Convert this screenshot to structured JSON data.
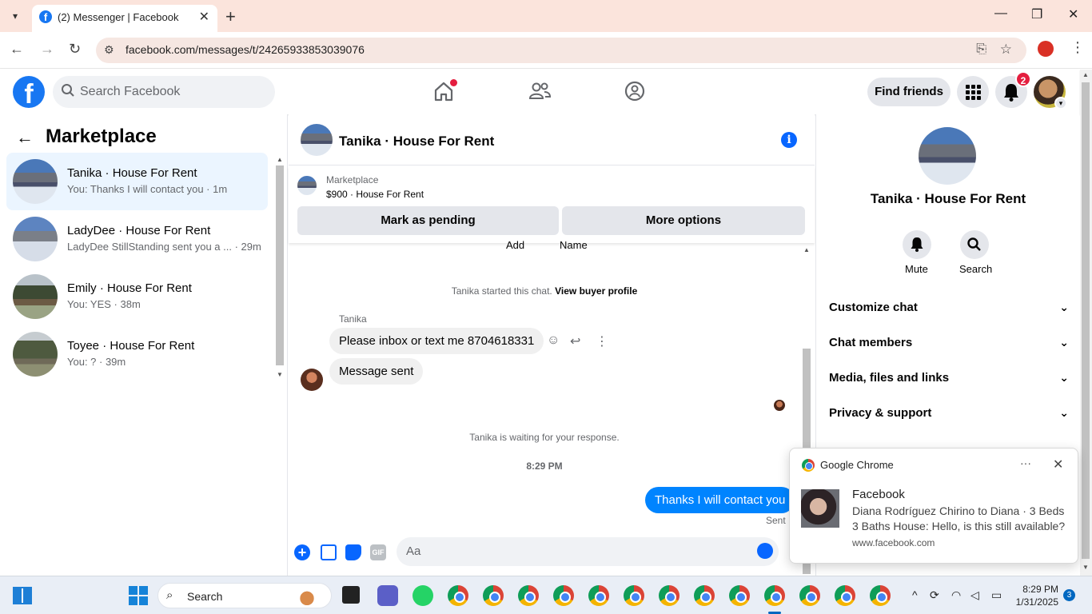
{
  "browser": {
    "tab_title": "(2) Messenger | Facebook",
    "url": "facebook.com/messages/t/24265933853039076",
    "new_tab_symbol": "+",
    "close_symbol": "✕"
  },
  "facebook": {
    "search_placeholder": "Search Facebook",
    "find_friends_label": "Find friends",
    "notification_count": "2"
  },
  "sidebar": {
    "title": "Marketplace",
    "conversations": [
      {
        "name": "Tanika · House For Rent",
        "preview": "You: Thanks I will contact you · 1m",
        "active": true
      },
      {
        "name": "LadyDee · House For Rent",
        "preview": "LadyDee StillStanding sent you a ... · 29m",
        "active": false
      },
      {
        "name": "Emily · House For Rent",
        "preview": "You: YES · 38m",
        "active": false
      },
      {
        "name": "Toyee · House For Rent",
        "preview": "You: ? · 39m",
        "active": false
      }
    ]
  },
  "chat": {
    "header_name": "Tanika · House For Rent",
    "listing": {
      "label": "Marketplace",
      "price_title": "$900 · House For Rent",
      "mark_pending_label": "Mark as pending",
      "more_options_label": "More options"
    },
    "cut_off_labels": [
      "Add",
      "Name"
    ],
    "started_text": "Tanika started this chat.",
    "buyer_profile_link": "View buyer profile",
    "sender_name": "Tanika",
    "messages_in": [
      "Please inbox or text me 8704618331",
      "Message sent"
    ],
    "waiting_text": "Tanika is waiting for your response.",
    "timestamp": "8:29 PM",
    "message_out": "Thanks I will contact you",
    "status": "Sent",
    "composer_placeholder": "Aa",
    "gif_label": "GIF"
  },
  "info_panel": {
    "name": "Tanika · House For Rent",
    "mute_label": "Mute",
    "search_label": "Search",
    "sections": [
      "Customize chat",
      "Chat members",
      "Media, files and links",
      "Privacy & support"
    ]
  },
  "notification": {
    "app": "Google Chrome",
    "title": "Facebook",
    "body": "Diana Rodríguez Chirino to Diana · 3 Beds 3 Baths House: Hello, is this still available?",
    "site": "www.facebook.com",
    "more_symbol": "···",
    "close_symbol": "✕"
  },
  "taskbar": {
    "search_placeholder": "Search",
    "time": "8:29 PM",
    "date": "1/31/2025",
    "badge": "3"
  },
  "colors": {
    "fb_blue": "#1877f2",
    "messenger_blue": "#0084ff",
    "tab_strip": "#fbe4dc",
    "active_conv": "#ebf5ff"
  }
}
